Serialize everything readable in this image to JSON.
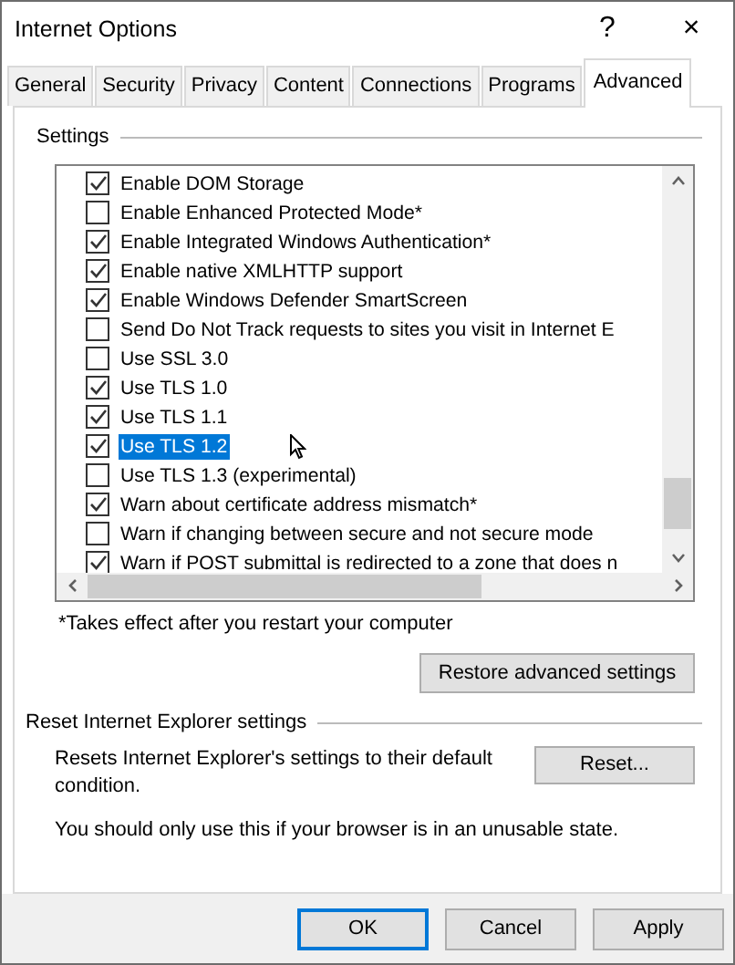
{
  "window": {
    "title": "Internet Options",
    "help": "?",
    "close": "×"
  },
  "tabs": [
    {
      "label": "General",
      "selected": false
    },
    {
      "label": "Security",
      "selected": false
    },
    {
      "label": "Privacy",
      "selected": false
    },
    {
      "label": "Content",
      "selected": false
    },
    {
      "label": "Connections",
      "selected": false
    },
    {
      "label": "Programs",
      "selected": false
    },
    {
      "label": "Advanced",
      "selected": true
    }
  ],
  "settings": {
    "label": "Settings",
    "items": [
      {
        "label": "Enable DOM Storage",
        "checked": true,
        "selected": false
      },
      {
        "label": "Enable Enhanced Protected Mode*",
        "checked": false,
        "selected": false
      },
      {
        "label": "Enable Integrated Windows Authentication*",
        "checked": true,
        "selected": false
      },
      {
        "label": "Enable native XMLHTTP support",
        "checked": true,
        "selected": false
      },
      {
        "label": "Enable Windows Defender SmartScreen",
        "checked": true,
        "selected": false
      },
      {
        "label": "Send Do Not Track requests to sites you visit in Internet E",
        "checked": false,
        "selected": false
      },
      {
        "label": "Use SSL 3.0",
        "checked": false,
        "selected": false
      },
      {
        "label": "Use TLS 1.0",
        "checked": true,
        "selected": false
      },
      {
        "label": "Use TLS 1.1",
        "checked": true,
        "selected": false
      },
      {
        "label": "Use TLS 1.2",
        "checked": true,
        "selected": true
      },
      {
        "label": "Use TLS 1.3 (experimental)",
        "checked": false,
        "selected": false
      },
      {
        "label": "Warn about certificate address mismatch*",
        "checked": true,
        "selected": false
      },
      {
        "label": "Warn if changing between secure and not secure mode",
        "checked": false,
        "selected": false
      },
      {
        "label": "Warn if POST submittal is redirected to a zone that does n",
        "checked": true,
        "selected": false
      }
    ]
  },
  "note": "*Takes effect after you restart your computer",
  "restore_button": "Restore advanced settings",
  "reset": {
    "label": "Reset Internet Explorer settings",
    "description": "Resets Internet Explorer's settings to their default condition.",
    "button": "Reset...",
    "warning": "You should only use this if your browser is in an unusable state."
  },
  "buttons": [
    {
      "label": "OK",
      "focused": true
    },
    {
      "label": "Cancel",
      "focused": false
    },
    {
      "label": "Apply",
      "focused": false
    }
  ]
}
